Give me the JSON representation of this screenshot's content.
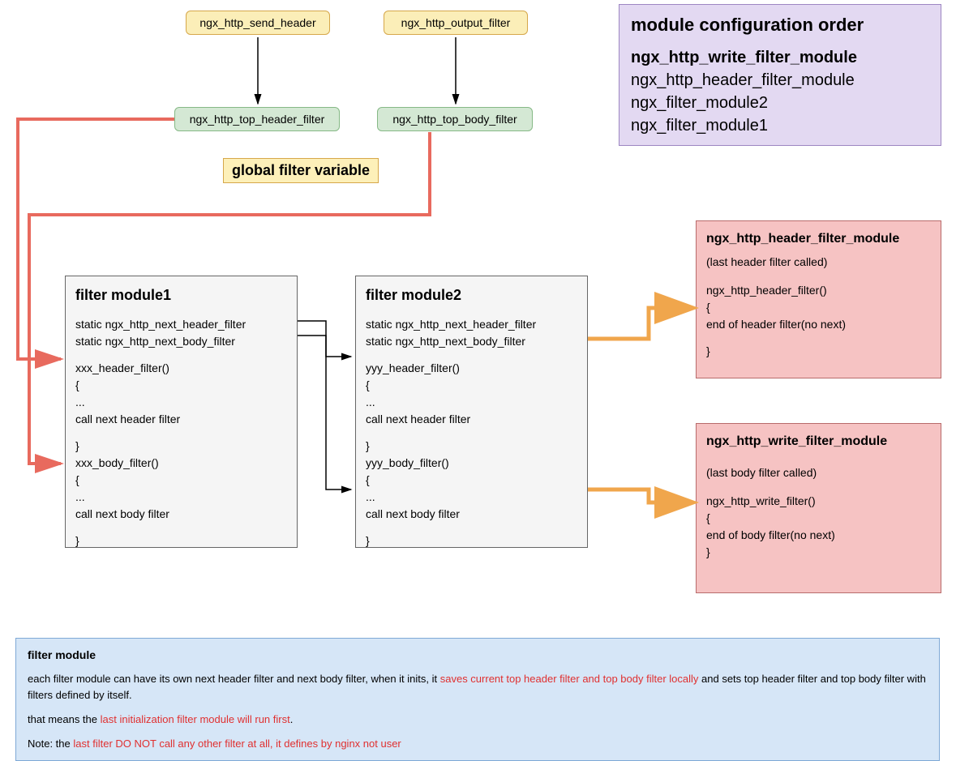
{
  "top": {
    "send_header": "ngx_http_send_header",
    "output_filter": "ngx_http_output_filter",
    "top_header_filter": "ngx_http_top_header_filter",
    "top_body_filter": "ngx_http_top_body_filter",
    "global_label": "global filter variable"
  },
  "config": {
    "title": "module configuration order",
    "line1": "ngx_http_write_filter_module",
    "line2": "ngx_http_header_filter_module",
    "line3": "ngx_filter_module2",
    "line4": "ngx_filter_module1"
  },
  "module1": {
    "title": "filter module1",
    "l1": "static ngx_http_next_header_filter",
    "l2": "static ngx_http_next_body_filter",
    "l3": "xxx_header_filter()",
    "l4": "{",
    "l5": "...",
    "l6": "call next header filter",
    "l7": "}",
    "l8": "xxx_body_filter()",
    "l9": "{",
    "l10": "...",
    "l11": "call next body filter",
    "l12": "}"
  },
  "module2": {
    "title": "filter module2",
    "l1": "static ngx_http_next_header_filter",
    "l2": "static ngx_http_next_body_filter",
    "l3": "yyy_header_filter()",
    "l4": "{",
    "l5": "...",
    "l6": "call next header filter",
    "l7": "}",
    "l8": "yyy_body_filter()",
    "l9": "{",
    "l10": "...",
    "l11": "call next body filter",
    "l12": "}"
  },
  "header_module": {
    "title": "ngx_http_header_filter_module",
    "sub": "(last header filter called)",
    "l1": "ngx_http_header_filter()",
    "l2": "{",
    "l3": "end of header filter(no next)",
    "l4": "}"
  },
  "write_module": {
    "title": "ngx_http_write_filter_module",
    "sub": "(last body filter called)",
    "l1": "ngx_http_write_filter()",
    "l2": "{",
    "l3": "end of body filter(no next)",
    "l4": "}"
  },
  "footer": {
    "title": "filter module",
    "p1a": "each filter module can have its own next header filter and next body filter, when it inits, it ",
    "p1b": "saves current top header filter and top body filter locally",
    "p1c": " and sets top header filter and top body filter with filters defined by itself.",
    "p2a": "that means the ",
    "p2b": "last initialization filter module will run first",
    "p2c": ".",
    "p3a": "Note: the ",
    "p3b": "last filter DO NOT call any other filter at all, it defines by nginx not user"
  }
}
